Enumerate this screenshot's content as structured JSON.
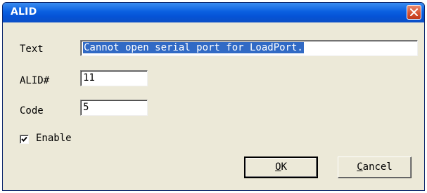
{
  "window": {
    "title": "ALID",
    "close_icon": "close-icon"
  },
  "form": {
    "text_label": "Text",
    "text_value": "Cannot open serial port for LoadPort.",
    "alid_label": "ALID#",
    "alid_value": "11",
    "code_label": "Code",
    "code_value": "5",
    "enable_label": "Enable",
    "enable_checked": true
  },
  "buttons": {
    "ok_mnemonic": "O",
    "ok_rest": "K",
    "cancel_mnemonic": "C",
    "cancel_rest": "ancel"
  },
  "colors": {
    "title_bar": "#0553d6",
    "selection": "#316ac5",
    "dialog_bg": "#ece9d8"
  }
}
